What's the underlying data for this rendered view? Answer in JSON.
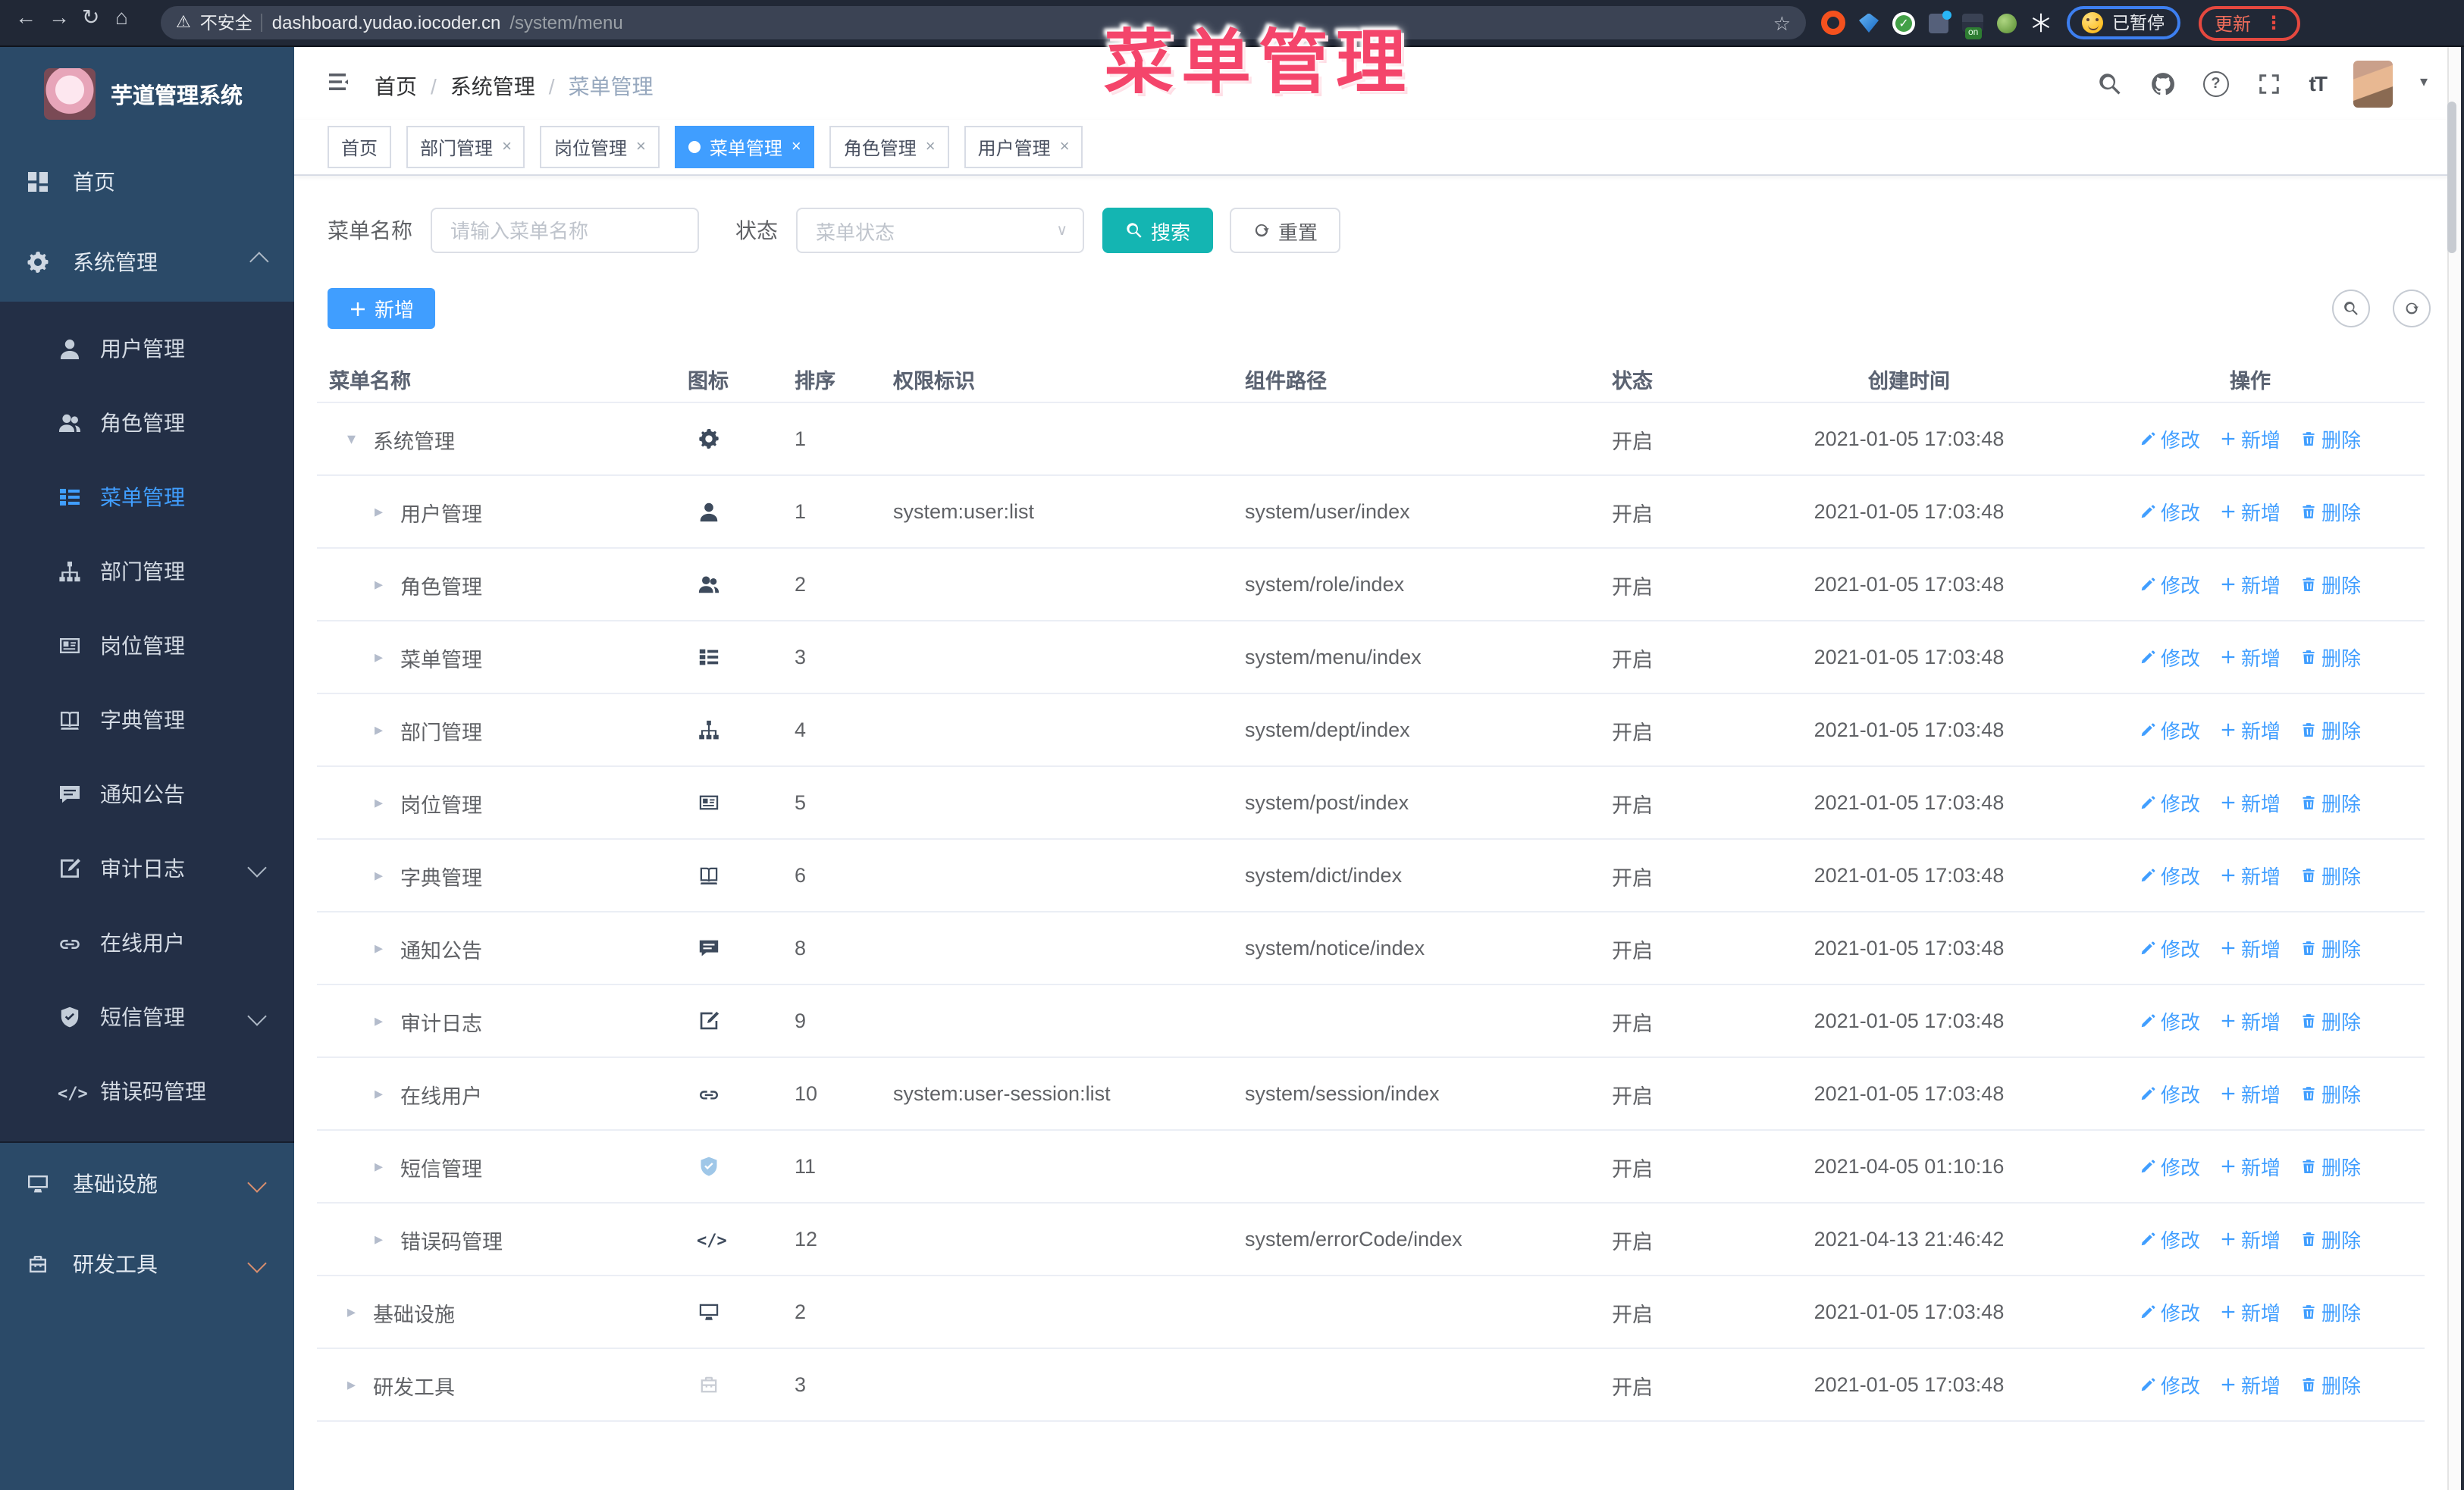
{
  "browser": {
    "security_label": "不安全",
    "url_host": "dashboard.yudao.iocoder.cn",
    "url_path": "/system/menu",
    "server_badge": "on",
    "paused_label": "已暂停",
    "update_label": "更新"
  },
  "overlay_title": "菜单管理",
  "sidebar": {
    "logo_title": "芋道管理系统",
    "items": [
      {
        "icon": "dashboard",
        "label": "首页",
        "level": 0
      },
      {
        "icon": "gear",
        "label": "系统管理",
        "level": 0,
        "chevron": "up"
      },
      {
        "icon": "user",
        "label": "用户管理",
        "level": 1
      },
      {
        "icon": "users",
        "label": "角色管理",
        "level": 1
      },
      {
        "icon": "tree-table",
        "label": "菜单管理",
        "level": 1,
        "active": true
      },
      {
        "icon": "tree",
        "label": "部门管理",
        "level": 1
      },
      {
        "icon": "id-card",
        "label": "岗位管理",
        "level": 1
      },
      {
        "icon": "books",
        "label": "字典管理",
        "level": 1
      },
      {
        "icon": "message",
        "label": "通知公告",
        "level": 1
      },
      {
        "icon": "form",
        "label": "审计日志",
        "level": 1,
        "chevron": "down"
      },
      {
        "icon": "link",
        "label": "在线用户",
        "level": 1
      },
      {
        "icon": "shield",
        "label": "短信管理",
        "level": 1,
        "chevron": "down"
      },
      {
        "icon": "code",
        "label": "错误码管理",
        "level": 1
      },
      {
        "icon": "monitor",
        "label": "基础设施",
        "level": 0,
        "chevron": "down",
        "warm": true
      },
      {
        "icon": "toolbox",
        "label": "研发工具",
        "level": 0,
        "chevron": "down",
        "warm": true
      }
    ]
  },
  "header": {
    "breadcrumb": [
      "首页",
      "系统管理",
      "菜单管理"
    ]
  },
  "tabs": [
    {
      "label": "首页",
      "closable": false,
      "active": false
    },
    {
      "label": "部门管理",
      "closable": true,
      "active": false
    },
    {
      "label": "岗位管理",
      "closable": true,
      "active": false
    },
    {
      "label": "菜单管理",
      "closable": true,
      "active": true
    },
    {
      "label": "角色管理",
      "closable": true,
      "active": false
    },
    {
      "label": "用户管理",
      "closable": true,
      "active": false
    }
  ],
  "filter": {
    "name_label": "菜单名称",
    "name_placeholder": "请输入菜单名称",
    "status_label": "状态",
    "status_placeholder": "菜单状态",
    "search_label": "搜索",
    "reset_label": "重置"
  },
  "toolbar": {
    "add_label": "新增"
  },
  "table": {
    "headers": [
      "菜单名称",
      "图标",
      "排序",
      "权限标识",
      "组件路径",
      "状态",
      "创建时间",
      "操作"
    ],
    "ops": {
      "edit": "修改",
      "add": "新增",
      "delete": "删除"
    },
    "rows": [
      {
        "level": 0,
        "caret": "down",
        "icon": "gear",
        "name": "系统管理",
        "sort": "1",
        "perm": "",
        "path": "",
        "status": "开启",
        "time": "2021-01-05 17:03:48"
      },
      {
        "level": 1,
        "caret": "right",
        "icon": "user",
        "name": "用户管理",
        "sort": "1",
        "perm": "system:user:list",
        "path": "system/user/index",
        "status": "开启",
        "time": "2021-01-05 17:03:48"
      },
      {
        "level": 1,
        "caret": "right",
        "icon": "users",
        "name": "角色管理",
        "sort": "2",
        "perm": "",
        "path": "system/role/index",
        "status": "开启",
        "time": "2021-01-05 17:03:48"
      },
      {
        "level": 1,
        "caret": "right",
        "icon": "tree-table",
        "name": "菜单管理",
        "sort": "3",
        "perm": "",
        "path": "system/menu/index",
        "status": "开启",
        "time": "2021-01-05 17:03:48"
      },
      {
        "level": 1,
        "caret": "right",
        "icon": "tree",
        "name": "部门管理",
        "sort": "4",
        "perm": "",
        "path": "system/dept/index",
        "status": "开启",
        "time": "2021-01-05 17:03:48"
      },
      {
        "level": 1,
        "caret": "right",
        "icon": "id-card",
        "name": "岗位管理",
        "sort": "5",
        "perm": "",
        "path": "system/post/index",
        "status": "开启",
        "time": "2021-01-05 17:03:48"
      },
      {
        "level": 1,
        "caret": "right",
        "icon": "books",
        "name": "字典管理",
        "sort": "6",
        "perm": "",
        "path": "system/dict/index",
        "status": "开启",
        "time": "2021-01-05 17:03:48"
      },
      {
        "level": 1,
        "caret": "right",
        "icon": "message",
        "name": "通知公告",
        "sort": "8",
        "perm": "",
        "path": "system/notice/index",
        "status": "开启",
        "time": "2021-01-05 17:03:48"
      },
      {
        "level": 1,
        "caret": "right",
        "icon": "form",
        "name": "审计日志",
        "sort": "9",
        "perm": "",
        "path": "",
        "status": "开启",
        "time": "2021-01-05 17:03:48"
      },
      {
        "level": 1,
        "caret": "right",
        "icon": "link",
        "name": "在线用户",
        "sort": "10",
        "perm": "system:user-session:list",
        "path": "system/session/index",
        "status": "开启",
        "time": "2021-01-05 17:03:48"
      },
      {
        "level": 1,
        "caret": "right",
        "icon": "shield",
        "icon_class": "lite",
        "name": "短信管理",
        "sort": "11",
        "perm": "",
        "path": "",
        "status": "开启",
        "time": "2021-04-05 01:10:16"
      },
      {
        "level": 1,
        "caret": "right",
        "icon": "code",
        "name": "错误码管理",
        "sort": "12",
        "perm": "",
        "path": "system/errorCode/index",
        "status": "开启",
        "time": "2021-04-13 21:46:42"
      },
      {
        "level": 0,
        "caret": "right",
        "icon": "monitor",
        "name": "基础设施",
        "sort": "2",
        "perm": "",
        "path": "",
        "status": "开启",
        "time": "2021-01-05 17:03:48"
      },
      {
        "level": 0,
        "caret": "right",
        "icon": "toolbox",
        "icon_class": "pale",
        "name": "研发工具",
        "sort": "3",
        "perm": "",
        "path": "",
        "status": "开启",
        "time": "2021-01-05 17:03:48"
      }
    ]
  }
}
